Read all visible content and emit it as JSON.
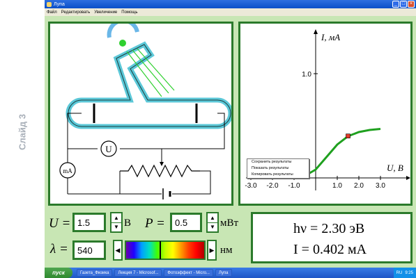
{
  "slide": {
    "label": "Слайд 3"
  },
  "window": {
    "title": "Лупа",
    "menu": [
      "Файл",
      "Редактировать",
      "Увеличение",
      "Помощь"
    ]
  },
  "circuit": {
    "voltmeter": "U",
    "ammeter": "mA"
  },
  "graph": {
    "ylabel": "I, мА",
    "xlabel": "U, В",
    "y_ticks": [
      "1.0"
    ],
    "x_ticks": [
      "-3.0",
      "-2.0",
      "-1.0",
      "1.0",
      "2.0",
      "3.0"
    ]
  },
  "chart_data": {
    "type": "line",
    "title": "",
    "xlabel": "U, В",
    "ylabel": "I, мА",
    "xlim": [
      -3.0,
      3.0
    ],
    "ylim": [
      0,
      1.1
    ],
    "x": [
      -1.0,
      -0.5,
      0.0,
      0.5,
      1.0,
      1.5,
      2.0,
      2.5,
      3.0
    ],
    "y": [
      0.0,
      0.02,
      0.08,
      0.2,
      0.32,
      0.4,
      0.44,
      0.46,
      0.47
    ],
    "marker": {
      "x": 1.5,
      "y": 0.402
    },
    "line_color": "#1fa01f",
    "marker_color": "#e23a2a"
  },
  "context_menu": {
    "items": [
      "Сохранить результаты",
      "Показать результаты",
      "Копировать результаты"
    ]
  },
  "controls": {
    "voltage": {
      "symbol": "U =",
      "value": "1.5",
      "unit": "В"
    },
    "power": {
      "symbol": "P =",
      "value": "0.5",
      "unit": "мВт"
    },
    "wavelength": {
      "symbol": "λ =",
      "value": "540",
      "unit": "нм"
    }
  },
  "results": {
    "energy": "hν = 2.30 эВ",
    "current": "I = 0.402 мА"
  },
  "taskbar": {
    "start": "пуск",
    "tasks": [
      "Газета_Физика",
      "Лекция 7 - Microsof...",
      "Фотоэффект - Micro...",
      "Лупа"
    ],
    "lang": "RU",
    "clock": "9:25"
  }
}
